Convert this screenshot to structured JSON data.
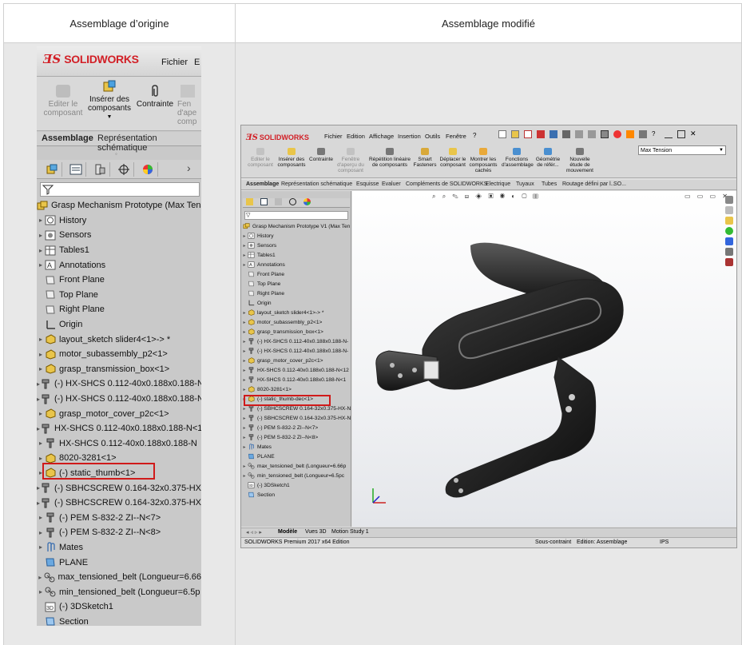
{
  "headers": {
    "left": "Assemblage d’origine",
    "right": "Assemblage modifié"
  },
  "left": {
    "app_name": "SOLIDWORKS",
    "menu": [
      "Fichier",
      "E"
    ],
    "commands": [
      {
        "label": "Editer le composant",
        "disabled": true
      },
      {
        "label": "Insérer des composants",
        "disabled": false
      },
      {
        "label": "Contrainte",
        "disabled": false
      },
      {
        "label": "Fen d'ape comp",
        "disabled": true
      }
    ],
    "tabs": [
      "Assemblage",
      "Représentation schématique"
    ],
    "tree": [
      {
        "label": "Grasp Mechanism Prototype  (Max Tensi",
        "icon": "assembly-icon",
        "exp": ""
      },
      {
        "label": "History",
        "icon": "history-icon",
        "exp": "▸"
      },
      {
        "label": "Sensors",
        "icon": "sensor-icon",
        "exp": "▸"
      },
      {
        "label": "Tables1",
        "icon": "table-icon",
        "exp": "▸"
      },
      {
        "label": "Annotations",
        "icon": "annotation-icon",
        "exp": "▸"
      },
      {
        "label": "Front Plane",
        "icon": "plane-icon",
        "exp": ""
      },
      {
        "label": "Top Plane",
        "icon": "plane-icon",
        "exp": ""
      },
      {
        "label": "Right Plane",
        "icon": "plane-icon",
        "exp": ""
      },
      {
        "label": "Origin",
        "icon": "origin-icon",
        "exp": ""
      },
      {
        "label": "layout_sketch slider4<1>-> *",
        "icon": "part-icon",
        "exp": "▸"
      },
      {
        "label": "motor_subassembly_p2<1>",
        "icon": "part-icon",
        "exp": "▸"
      },
      {
        "label": "grasp_transmission_box<1>",
        "icon": "part-icon",
        "exp": "▸"
      },
      {
        "label": "(-) HX-SHCS 0.112-40x0.188x0.188-N",
        "icon": "screw-icon",
        "exp": "▸"
      },
      {
        "label": "(-) HX-SHCS 0.112-40x0.188x0.188-N",
        "icon": "screw-icon",
        "exp": "▸"
      },
      {
        "label": "grasp_motor_cover_p2c<1>",
        "icon": "part-icon",
        "exp": "▸"
      },
      {
        "label": "HX-SHCS 0.112-40x0.188x0.188-N<1;",
        "icon": "screw-icon",
        "exp": "▸"
      },
      {
        "label": "HX-SHCS 0.112-40x0.188x0.188-N",
        "icon": "screw-icon",
        "exp": "▸"
      },
      {
        "label": "8020-3281<1>",
        "icon": "part-icon",
        "exp": "▸"
      },
      {
        "label": "(-) static_thumb<1>",
        "icon": "part-icon",
        "exp": "▸"
      },
      {
        "label": "(-) SBHCSCREW 0.164-32x0.375-HX-I",
        "icon": "screw-icon",
        "exp": "▸"
      },
      {
        "label": "(-) SBHCSCREW 0.164-32x0.375-HX-I",
        "icon": "screw-icon",
        "exp": "▸"
      },
      {
        "label": "(-) PEM S-832-2 ZI--N<7>",
        "icon": "screw-icon",
        "exp": "▸"
      },
      {
        "label": "(-) PEM S-832-2 ZI--N<8>",
        "icon": "screw-icon",
        "exp": "▸"
      },
      {
        "label": "Mates",
        "icon": "mates-icon",
        "exp": "▸"
      },
      {
        "label": "PLANE",
        "icon": "plane-blue-icon",
        "exp": ""
      },
      {
        "label": "max_tensioned_belt (Longueur=6.66",
        "icon": "belt-icon",
        "exp": "▸"
      },
      {
        "label": "min_tensioned_belt (Longueur=6.5p",
        "icon": "belt-icon",
        "exp": "▸"
      },
      {
        "label": "(-) 3DSketch1",
        "icon": "sketch3d-icon",
        "exp": ""
      },
      {
        "label": "Section",
        "icon": "section-icon",
        "exp": ""
      }
    ]
  },
  "right": {
    "app_name": "SOLIDWORKS",
    "menu": [
      "Fichier",
      "Edition",
      "Affichage",
      "Insertion",
      "Outils",
      "Fenêtre"
    ],
    "config": "Max Tension",
    "commands": [
      {
        "label": "Editer le composant",
        "disabled": true
      },
      {
        "label": "Insérer des composants",
        "disabled": false
      },
      {
        "label": "Contrainte",
        "disabled": false
      },
      {
        "label": "Fenêtre d'aperçu du composant",
        "disabled": true
      },
      {
        "label": "Répétition linéaire de composants",
        "disabled": false
      },
      {
        "label": "Smart Fasteners",
        "disabled": false
      },
      {
        "label": "Déplacer le composant",
        "disabled": false
      },
      {
        "label": "Montrer les composants cachés",
        "disabled": false
      },
      {
        "label": "Fonctions d'assemblage",
        "disabled": false
      },
      {
        "label": "Géométrie de référ...",
        "disabled": false
      },
      {
        "label": "Nouvelle étude de mouvement",
        "disabled": false
      }
    ],
    "tabs": [
      "Assemblage",
      "Représentation schématique",
      "Esquisse",
      "Evaluer",
      "Compléments de SOLIDWORKS",
      "Electrique",
      "Tuyaux",
      "Tubes",
      "Routage défini par l...",
      "SO..."
    ],
    "tree": [
      {
        "label": "Grasp Mechanism Prototype V1  (Max Ten",
        "exp": ""
      },
      {
        "label": "History",
        "exp": "▸"
      },
      {
        "label": "Sensors",
        "exp": "▸"
      },
      {
        "label": "Tables1",
        "exp": "▸"
      },
      {
        "label": "Annotations",
        "exp": "▸"
      },
      {
        "label": "Front Plane",
        "exp": ""
      },
      {
        "label": "Top Plane",
        "exp": ""
      },
      {
        "label": "Right Plane",
        "exp": ""
      },
      {
        "label": "Origin",
        "exp": ""
      },
      {
        "label": "layout_sketch slider4<1>-> *",
        "exp": "▸"
      },
      {
        "label": "motor_subassembly_p2<1>",
        "exp": "▸"
      },
      {
        "label": "grasp_transmission_box<1>",
        "exp": "▸"
      },
      {
        "label": "(-) HX-SHCS 0.112-40x0.188x0.188-N-",
        "exp": "▸"
      },
      {
        "label": "(-) HX-SHCS 0.112-40x0.188x0.188-N-",
        "exp": "▸"
      },
      {
        "label": "grasp_motor_cover_p2c<1>",
        "exp": "▸"
      },
      {
        "label": "HX-SHCS 0.112-40x0.188x0.188-N<12",
        "exp": "▸"
      },
      {
        "label": "HX-SHCS 0.112-40x0.188x0.188-N<1",
        "exp": "▸"
      },
      {
        "label": "8020-3281<1>",
        "exp": "▸"
      },
      {
        "label": "(-) static_thumb-dec<1>",
        "exp": "▸"
      },
      {
        "label": "(-) SBHCSCREW 0.164-32x0.375-HX-N",
        "exp": "▸"
      },
      {
        "label": "(-) SBHCSCREW 0.164-32x0.375-HX-N",
        "exp": "▸"
      },
      {
        "label": "(-) PEM S-832-2 ZI--N<7>",
        "exp": "▸"
      },
      {
        "label": "(-) PEM S-832-2 ZI--N<8>",
        "exp": "▸"
      },
      {
        "label": "Mates",
        "exp": "▸"
      },
      {
        "label": "PLANE",
        "exp": ""
      },
      {
        "label": "max_tensioned_belt (Longueur=6.66p",
        "exp": "▸"
      },
      {
        "label": "min_tensioned_belt (Longueur=6.5pc",
        "exp": "▸"
      },
      {
        "label": "(-) 3DSketch1",
        "exp": ""
      },
      {
        "label": "Section",
        "exp": ""
      }
    ],
    "bottom_tabs": [
      "Modèle",
      "Vues 3D",
      "Motion Study 1"
    ],
    "status": {
      "product": "SOLIDWORKS Premium 2017 x64 Edition",
      "constraint": "Sous-contraint",
      "mode": "Edition: Assemblage",
      "units": "IPS"
    }
  }
}
